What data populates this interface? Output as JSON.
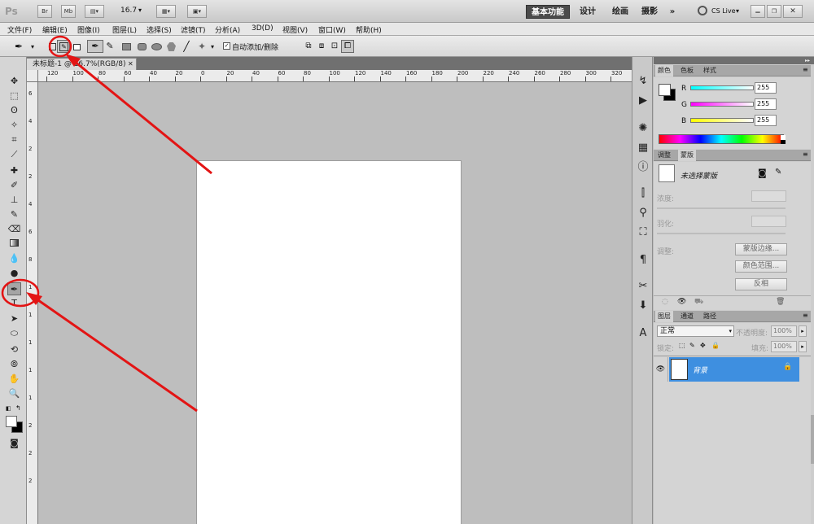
{
  "appbar": {
    "logo": "Ps",
    "br": "Br",
    "mb": "Mb",
    "zoom": "16.7",
    "ws": [
      "基本功能",
      "设计",
      "绘画",
      "摄影"
    ],
    "more": "»",
    "cslive": "CS Live"
  },
  "menu": [
    "文件(F)",
    "编辑(E)",
    "图像(I)",
    "图层(L)",
    "选择(S)",
    "滤镜(T)",
    "分析(A)",
    "3D(D)",
    "视图(V)",
    "窗口(W)",
    "帮助(H)"
  ],
  "options": {
    "auto_add": "自动添加/删除"
  },
  "doc": {
    "title": "未标题-1 @ 16.7%(RGB/8)"
  },
  "ruler": {
    "top": [
      "120",
      "100",
      "80",
      "60",
      "40",
      "20",
      "0",
      "20",
      "40",
      "60",
      "80",
      "100",
      "120",
      "140",
      "160",
      "180",
      "200",
      "220",
      "240",
      "260",
      "280",
      "300",
      "320"
    ],
    "left": [
      "6",
      "4",
      "2",
      "2",
      "4",
      "6",
      "8",
      "1",
      "1",
      "1",
      "1",
      "1",
      "2",
      "2",
      "2"
    ]
  },
  "color": {
    "tabs": [
      "颜色",
      "色板",
      "样式"
    ],
    "channels": [
      {
        "label": "R",
        "value": "255"
      },
      {
        "label": "G",
        "value": "255"
      },
      {
        "label": "B",
        "value": "255"
      }
    ]
  },
  "masks": {
    "tabs": [
      "调整",
      "蒙版"
    ],
    "none": "未选择蒙版",
    "density": "浓度:",
    "feather": "羽化:",
    "refine": "调整:",
    "edge": "蒙版边缘...",
    "range": "颜色范围...",
    "invert": "反相"
  },
  "layers": {
    "tabs": [
      "图层",
      "通道",
      "路径"
    ],
    "mode": "正常",
    "opacity_label": "不透明度:",
    "opacity": "100%",
    "lock_label": "锁定:",
    "fill_label": "填充:",
    "fill": "100%",
    "layer_name": "背景"
  },
  "accent": "#3e8fe0",
  "annotation": "#e31414"
}
